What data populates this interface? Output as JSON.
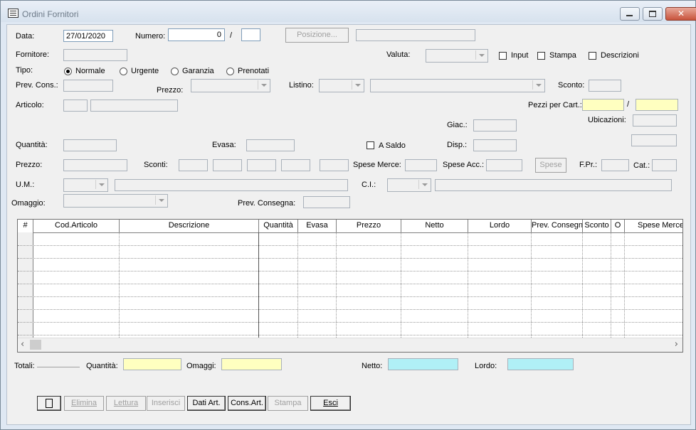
{
  "window": {
    "title": "Ordini Fornitori"
  },
  "header": {
    "data_label": "Data:",
    "data_value": "27/01/2020",
    "numero_label": "Numero:",
    "numero_value": "0",
    "slash": "/",
    "posizione_button": "Posizione...",
    "fornitore_label": "Fornitore:",
    "valuta_label": "Valuta:",
    "input_label": "Input",
    "stampa_label": "Stampa",
    "descrizioni_label": "Descrizioni",
    "tipo_label": "Tipo:",
    "tipo_options": [
      "Normale",
      "Urgente",
      "Garanzia",
      "Prenotati"
    ],
    "tipo_selected": "Normale",
    "prev_cons_label": "Prev. Cons.:",
    "prezzo_label": "Prezzo:",
    "listino_label": "Listino:",
    "sconto_label": "Sconto:",
    "articolo_label": "Articolo:",
    "pezzi_label": "Pezzi per Cart.:",
    "pezzi_slash": "/",
    "giac_label": "Giac.:",
    "ubicazioni_label": "Ubicazioni:",
    "quantita_label": "Quantità:",
    "evasa_label": "Evasa:",
    "a_saldo_label": "A Saldo",
    "disp_label": "Disp.:",
    "prezzo2_label": "Prezzo:",
    "sconti_label": "Sconti:",
    "spese_merce_label": "Spese Merce:",
    "spese_acc_label": "Spese Acc.:",
    "spese_button": "Spese",
    "fpr_label": "F.Pr.:",
    "cat_label": "Cat.:",
    "um_label": "U.M.:",
    "ci_label": "C.I.:",
    "omaggio_label": "Omaggio:",
    "prev_consegna_label": "Prev. Consegna:"
  },
  "table": {
    "columns": [
      "#",
      "Cod.Articolo",
      "Descrizione",
      "Quantità",
      "Evasa",
      "Prezzo",
      "Netto",
      "Lordo",
      "Prev. Consegn",
      "Sconto",
      "O",
      "Spese Merce"
    ],
    "rows": []
  },
  "totals": {
    "totali_label": "Totali:",
    "quantita_label": "Quantità:",
    "omaggi_label": "Omaggi:",
    "netto_label": "Netto:",
    "lordo_label": "Lordo:"
  },
  "toolbar": {
    "new_label": "",
    "elimina": "Elimina",
    "lettura": "Lettura",
    "inserisci": "Inserisci",
    "dati_art": "Dati Art.",
    "cons_art": "Cons.Art.",
    "stampa": "Stampa",
    "esci": "Esci"
  },
  "colors": {
    "yellow_field": "#ffffc0",
    "cyan_field": "#b0f0f6"
  }
}
